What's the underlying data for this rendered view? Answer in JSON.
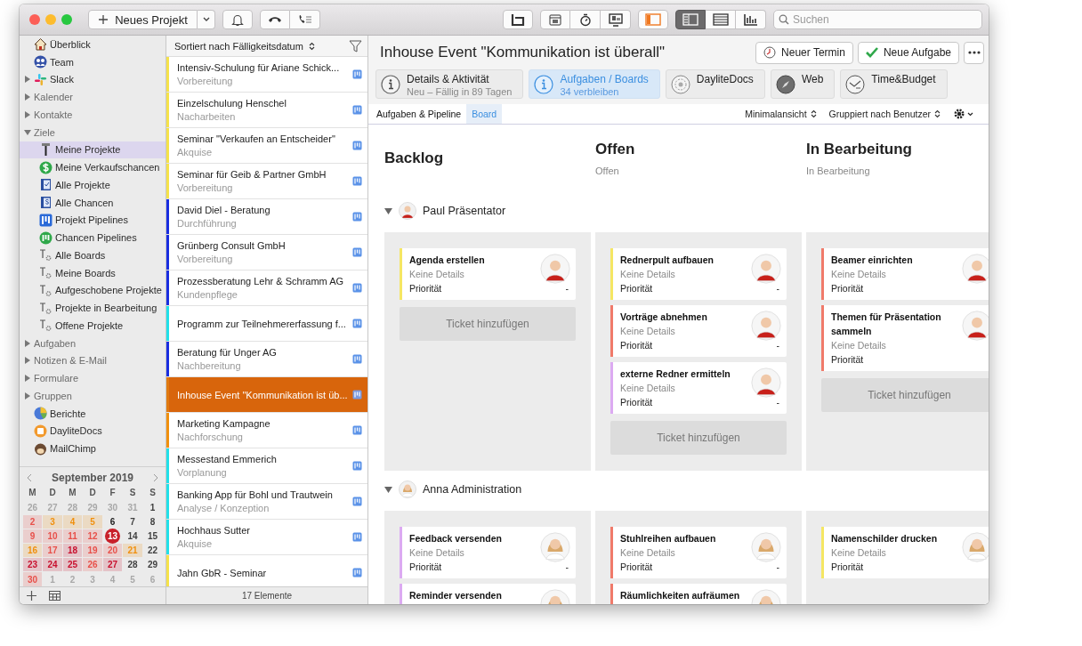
{
  "toolbar": {
    "new_button": "Neues Projekt",
    "view_buttons": [
      {
        "kind": "columns",
        "selected": true
      },
      {
        "kind": "list",
        "selected": false
      },
      {
        "kind": "chart",
        "selected": false
      }
    ],
    "search": {
      "placeholder": "Suchen"
    }
  },
  "sidebar": {
    "items": [
      {
        "label": "Überblick",
        "kind": "home",
        "selected": false
      },
      {
        "label": "Team",
        "kind": "team",
        "selected": false
      },
      {
        "label": "Slack",
        "kind": "slack",
        "selected": false,
        "expanded": false
      },
      {
        "label": "Kalender",
        "kind": "section",
        "selected": false,
        "expanded": false
      },
      {
        "label": "Kontakte",
        "kind": "section",
        "selected": false,
        "expanded": false
      },
      {
        "label": "Ziele",
        "kind": "section",
        "selected": false,
        "expanded": true,
        "children": [
          {
            "label": "Meine Projekte",
            "kind": "hammer",
            "selected": true
          },
          {
            "label": "Meine Verkaufschancen",
            "kind": "dollar",
            "selected": false
          },
          {
            "label": "Alle Projekte",
            "kind": "notebook",
            "selected": false
          },
          {
            "label": "Alle Chancen",
            "kind": "notebook-dollar",
            "selected": false
          },
          {
            "label": "Projekt Pipelines",
            "kind": "pipeline",
            "selected": false
          },
          {
            "label": "Chancen Pipelines",
            "kind": "pipeline-round",
            "selected": false
          },
          {
            "label": "Alle Boards",
            "kind": "board",
            "selected": false
          },
          {
            "label": "Meine Boards",
            "kind": "board",
            "selected": false
          },
          {
            "label": "Aufgeschobene Projekte",
            "kind": "board",
            "selected": false
          },
          {
            "label": "Projekte in Bearbeitung",
            "kind": "board",
            "selected": false
          },
          {
            "label": "Offene Projekte",
            "kind": "board",
            "selected": false
          }
        ]
      },
      {
        "label": "Aufgaben",
        "kind": "section",
        "selected": false,
        "expanded": false
      },
      {
        "label": "Notizen & E-Mail",
        "kind": "section",
        "selected": false,
        "expanded": false
      },
      {
        "label": "Formulare",
        "kind": "section",
        "selected": false,
        "expanded": false
      },
      {
        "label": "Gruppen",
        "kind": "section",
        "selected": false,
        "expanded": false
      },
      {
        "label": "Berichte",
        "kind": "reports",
        "selected": false
      },
      {
        "label": "DayliteDocs",
        "kind": "docs",
        "selected": false
      },
      {
        "label": "MailChimp",
        "kind": "mail",
        "selected": false
      }
    ]
  },
  "calendar": {
    "month": "September 2019",
    "weekdays": [
      "M",
      "D",
      "M",
      "D",
      "F",
      "S",
      "S"
    ],
    "days": [
      {
        "label": "26",
        "color": "#a8a8a8",
        "highlight": false,
        "today": false
      },
      {
        "label": "27",
        "color": "#a8a8a8",
        "highlight": false,
        "today": false
      },
      {
        "label": "28",
        "color": "#a8a8a8",
        "highlight": false,
        "today": false
      },
      {
        "label": "29",
        "color": "#a8a8a8",
        "highlight": false,
        "today": false
      },
      {
        "label": "30",
        "color": "#a8a8a8",
        "highlight": false,
        "today": false
      },
      {
        "label": "31",
        "color": "#a8a8a8",
        "highlight": false,
        "today": false
      },
      {
        "label": "1",
        "color": "#404040",
        "highlight": false,
        "today": false
      },
      {
        "label": "2",
        "color": "#e8504a",
        "highlight": true,
        "today": false
      },
      {
        "label": "3",
        "color": "#f0900e",
        "highlight": true,
        "today": false
      },
      {
        "label": "4",
        "color": "#f0900e",
        "highlight": true,
        "today": false
      },
      {
        "label": "5",
        "color": "#f0900e",
        "highlight": true,
        "today": false
      },
      {
        "label": "6",
        "color": "#202020",
        "highlight": false,
        "today": false
      },
      {
        "label": "7",
        "color": "#404040",
        "highlight": false,
        "today": false
      },
      {
        "label": "8",
        "color": "#404040",
        "highlight": false,
        "today": false
      },
      {
        "label": "9",
        "color": "#e8504a",
        "highlight": true,
        "today": false
      },
      {
        "label": "10",
        "color": "#e8504a",
        "highlight": true,
        "today": false
      },
      {
        "label": "11",
        "color": "#e8504a",
        "highlight": true,
        "today": false
      },
      {
        "label": "12",
        "color": "#e8504a",
        "highlight": true,
        "today": false
      },
      {
        "label": "13",
        "color": "#c8202a",
        "highlight": false,
        "today": true
      },
      {
        "label": "14",
        "color": "#404040",
        "highlight": false,
        "today": false
      },
      {
        "label": "15",
        "color": "#404040",
        "highlight": false,
        "today": false
      },
      {
        "label": "16",
        "color": "#f0900e",
        "highlight": true,
        "today": false
      },
      {
        "label": "17",
        "color": "#e8504a",
        "highlight": true,
        "today": false
      },
      {
        "label": "18",
        "color": "#c8102e",
        "highlight": true,
        "today": false
      },
      {
        "label": "19",
        "color": "#e8504a",
        "highlight": true,
        "today": false
      },
      {
        "label": "20",
        "color": "#e8504a",
        "highlight": true,
        "today": false
      },
      {
        "label": "21",
        "color": "#f0900e",
        "highlight": true,
        "today": false
      },
      {
        "label": "22",
        "color": "#404040",
        "highlight": false,
        "today": false
      },
      {
        "label": "23",
        "color": "#c8102e",
        "highlight": true,
        "today": false
      },
      {
        "label": "24",
        "color": "#c8102e",
        "highlight": true,
        "today": false
      },
      {
        "label": "25",
        "color": "#c8102e",
        "highlight": true,
        "today": false
      },
      {
        "label": "26",
        "color": "#e8504a",
        "highlight": true,
        "today": false
      },
      {
        "label": "27",
        "color": "#c8102e",
        "highlight": true,
        "today": false
      },
      {
        "label": "28",
        "color": "#404040",
        "highlight": false,
        "today": false
      },
      {
        "label": "29",
        "color": "#404040",
        "highlight": false,
        "today": false
      },
      {
        "label": "30",
        "color": "#e8504a",
        "highlight": true,
        "today": false
      },
      {
        "label": "1",
        "color": "#a8a8a8",
        "highlight": false,
        "today": false
      },
      {
        "label": "2",
        "color": "#a8a8a8",
        "highlight": false,
        "today": false
      },
      {
        "label": "3",
        "color": "#a8a8a8",
        "highlight": false,
        "today": false
      },
      {
        "label": "4",
        "color": "#a8a8a8",
        "highlight": false,
        "today": false
      },
      {
        "label": "5",
        "color": "#a8a8a8",
        "highlight": false,
        "today": false
      },
      {
        "label": "6",
        "color": "#a8a8a8",
        "highlight": false,
        "today": false
      }
    ]
  },
  "project_list": {
    "sort_label": "Sortiert nach Fälligkeitsdatum",
    "footer": "17 Elemente",
    "rows": [
      {
        "title": "Intensiv-Schulung für Ariane Schick...",
        "subtitle": "Vorbereitung",
        "color": "#f5e24a",
        "selected": false
      },
      {
        "title": "Einzelschulung Henschel",
        "subtitle": "Nacharbeiten",
        "color": "#f5e24a",
        "selected": false
      },
      {
        "title": "Seminar \"Verkaufen an Entscheider\"",
        "subtitle": "Akquise",
        "color": "#f5e24a",
        "selected": false
      },
      {
        "title": "Seminar für Geib & Partner GmbH",
        "subtitle": "Vorbereitung",
        "color": "#f5e24a",
        "selected": false
      },
      {
        "title": "David Diel - Beratung",
        "subtitle": "Durchführung",
        "color": "#1a2ee0",
        "selected": false
      },
      {
        "title": "Grünberg Consult GmbH",
        "subtitle": "Vorbereitung",
        "color": "#1a2ee0",
        "selected": false
      },
      {
        "title": "Prozessberatung Lehr & Schramm AG",
        "subtitle": "Kundenpflege",
        "color": "#1a2ee0",
        "selected": false
      },
      {
        "title": "Programm zur Teilnehmererfassung f...",
        "color": "#22e0e8",
        "selected": false
      },
      {
        "title": "Beratung für Unger AG",
        "subtitle": "Nachbereitung",
        "color": "#1a2ee0",
        "selected": false
      },
      {
        "title": "Inhouse Event \"Kommunikation ist üb...",
        "color": "#e07a10",
        "selected": true
      },
      {
        "title": "Marketing Kampagne",
        "subtitle": "Nachforschung",
        "color": "#f0900e",
        "selected": false
      },
      {
        "title": "Messestand Emmerich",
        "subtitle": "Vorplanung",
        "color": "#22e0e8",
        "selected": false
      },
      {
        "title": "Banking App für Bohl und Trautwein",
        "subtitle": "Analyse / Konzeption",
        "color": "#22e0e8",
        "selected": false
      },
      {
        "title": "Hochhaus Sutter",
        "subtitle": "Akquise",
        "color": "#22e0e8",
        "selected": false
      },
      {
        "title": "Jahn GbR - Seminar",
        "color": "#f5e24a",
        "selected": false
      }
    ]
  },
  "detail": {
    "title": "Inhouse Event \"Kommunikation ist überall\"",
    "buttons": [
      {
        "kind": "appointment",
        "label": "Neuer Termin"
      },
      {
        "kind": "task",
        "label": "Neue Aufgabe"
      }
    ],
    "tabs": [
      {
        "kind": "info",
        "label": "Details & Aktivität",
        "sublabel": "Neu – Fällig in 89 Tagen",
        "selected": false
      },
      {
        "kind": "info",
        "label": "Aufgaben / Boards",
        "sublabel": "34 verbleiben",
        "selected": true
      },
      {
        "kind": "docs",
        "label": "DayliteDocs",
        "selected": false
      },
      {
        "kind": "web",
        "label": "Web",
        "selected": false
      },
      {
        "kind": "budget",
        "label": "Time&Budget",
        "selected": false
      }
    ],
    "view_tabs": [
      {
        "label": "Aufgaben & Pipeline",
        "selected": false
      },
      {
        "label": "Board",
        "selected": true
      }
    ],
    "view_options": [
      "Minimalansicht",
      "Gruppiert nach Benutzer"
    ]
  },
  "board": {
    "columns": [
      {
        "title": "Backlog"
      },
      {
        "title": "Offen",
        "subtitle": "Offen"
      },
      {
        "title": "In Bearbeitung",
        "subtitle": "In Bearbeitung"
      }
    ],
    "groups": [
      {
        "name": "Paul Präsentator",
        "kind": "man",
        "expanded": true,
        "lanes": [
          {
            "cards": [
              {
                "title": "Agenda erstellen",
                "details": "Keine Details",
                "priority_label": "Priorität",
                "priority_value": "-",
                "color": "#f5e663"
              }
            ],
            "add_button": "Ticket hinzufügen"
          },
          {
            "cards": [
              {
                "title": "Rednerpult aufbauen",
                "details": "Keine Details",
                "priority_label": "Priorität",
                "priority_value": "-",
                "color": "#f5e663"
              },
              {
                "title": "Vorträge abnehmen",
                "details": "Keine Details",
                "priority_label": "Priorität",
                "priority_value": "-",
                "color": "#f07a6a"
              },
              {
                "title": "externe Redner ermitteln",
                "details": "Keine Details",
                "priority_label": "Priorität",
                "priority_value": "-",
                "color": "#dcaaf2"
              }
            ],
            "add_button": "Ticket hinzufügen"
          },
          {
            "cards": [
              {
                "title": "Beamer einrichten",
                "details": "Keine Details",
                "priority_label": "Priorität",
                "color": "#f07a6a"
              },
              {
                "title": "Themen für Präsentation sammeln",
                "details": "Keine Details",
                "priority_label": "Priorität",
                "color": "#f07a6a"
              }
            ],
            "add_button": "Ticket hinzufügen"
          }
        ]
      },
      {
        "name": "Anna Administration",
        "kind": "woman",
        "expanded": true,
        "lanes": [
          {
            "cards": [
              {
                "title": "Feedback versenden",
                "details": "Keine Details",
                "priority_label": "Priorität",
                "priority_value": "-",
                "color": "#dcaaf2"
              },
              {
                "title": "Reminder versenden",
                "color": "#dcaaf2"
              }
            ]
          },
          {
            "cards": [
              {
                "title": "Stuhlreihen aufbauen",
                "details": "Keine Details",
                "priority_label": "Priorität",
                "priority_value": "-",
                "color": "#f07a6a"
              },
              {
                "title": "Räumlichkeiten aufräumen",
                "color": "#f07a6a"
              }
            ]
          },
          {
            "cards": [
              {
                "title": "Namenschilder drucken",
                "details": "Keine Details",
                "priority_label": "Priorität",
                "color": "#f5e663"
              }
            ]
          }
        ]
      }
    ]
  }
}
